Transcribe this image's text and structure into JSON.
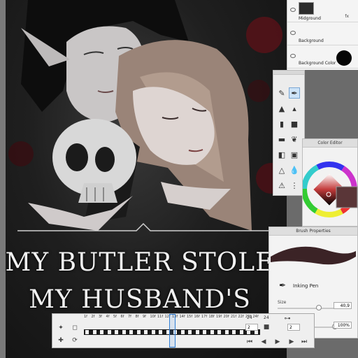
{
  "artwork": {
    "title_line_1": "MY BUTLER STOLE",
    "title_line_2": "MY HUSBAND'S FACE"
  },
  "layers": [
    {
      "name": "Midground",
      "extra": "fx"
    },
    {
      "name": "Background"
    },
    {
      "name": "Background Color"
    }
  ],
  "tools": {
    "icons": [
      "pencil-icon",
      "inking-pen-icon",
      "airbrush-icon",
      "paint-brush-icon",
      "marker-icon",
      "fill-bucket-icon",
      "eraser-icon",
      "smudge-icon",
      "blur-icon",
      "fan-brush-icon",
      "bucket-icon",
      "water-drop-icon",
      "triangle-icon",
      "sharpen-icon"
    ],
    "selected": "inking-pen-icon"
  },
  "color_editor": {
    "title": "Color Editor",
    "current_color": "#5a3638"
  },
  "brush_properties": {
    "title": "Brush Properties",
    "brush_name": "Inking Pen",
    "size_label": "Size",
    "size_value": "40,9",
    "size_fraction": 0.72,
    "opacity_value": "100%",
    "opacity_fraction": 1.0
  },
  "timeline": {
    "frame_labels": [
      "1f",
      "2f",
      "3f",
      "4f",
      "5f",
      "6f",
      "7f",
      "8f",
      "9f",
      "10f",
      "11f",
      "12f",
      "13f",
      "14f",
      "15f",
      "16f",
      "17f",
      "18f",
      "19f",
      "20f",
      "21f",
      "22f",
      "23f",
      "24f"
    ],
    "current_frame": "6f",
    "frame_count": "24",
    "fps_label": "24",
    "speed_value": "2",
    "loop_value": "2"
  }
}
